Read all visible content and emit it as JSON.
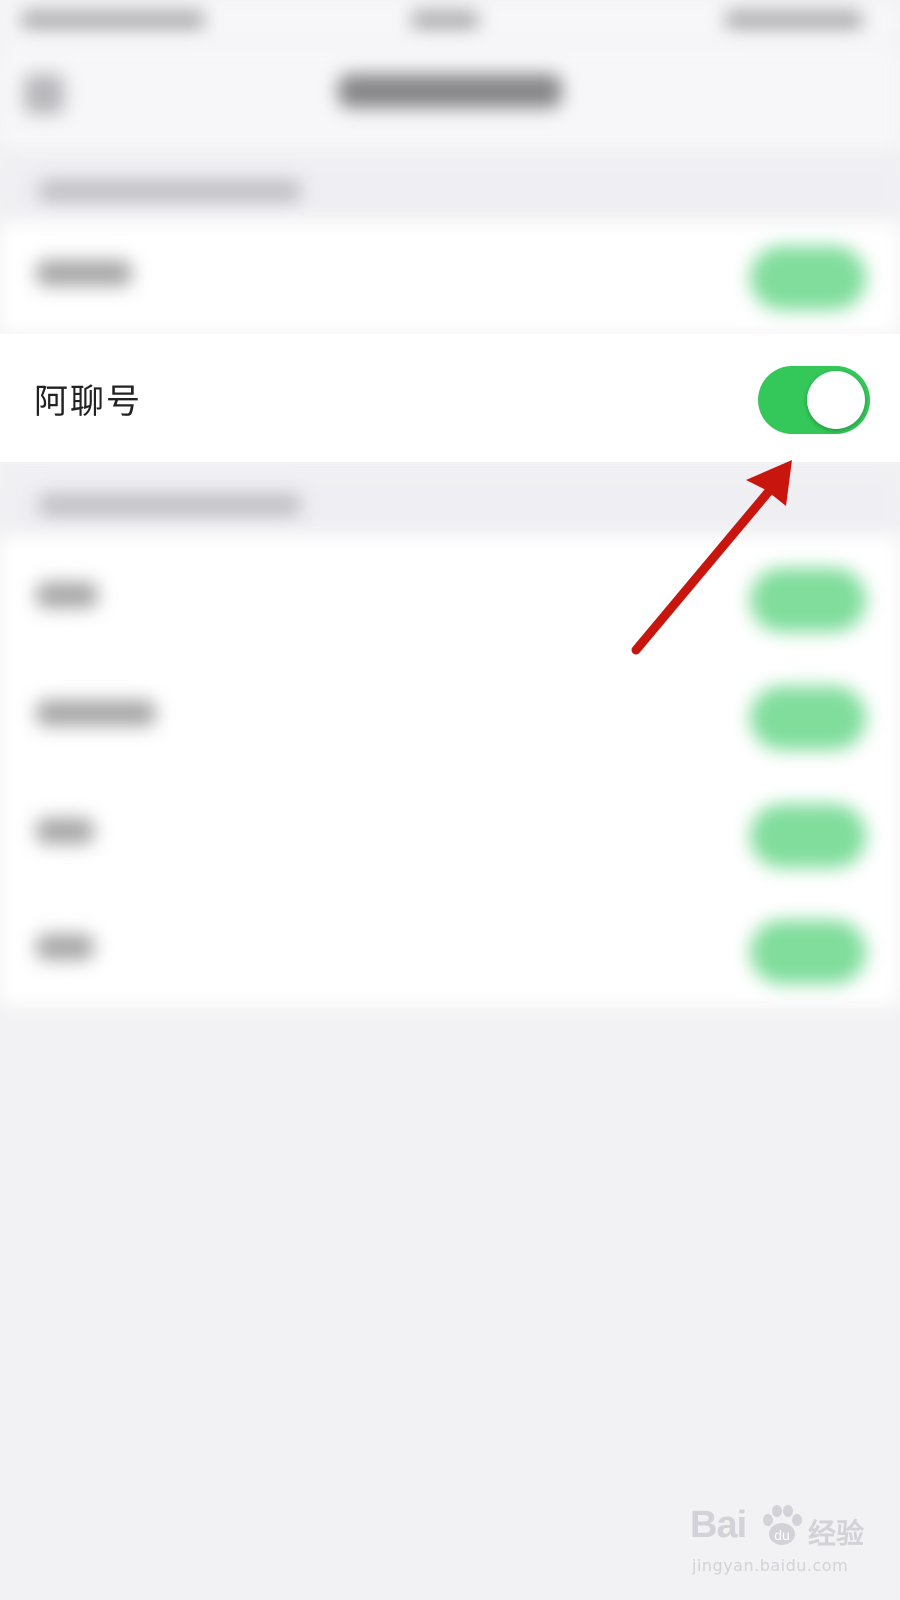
{
  "settings": {
    "highlighted_item": {
      "label": "阿聊号",
      "toggle_on": true
    }
  },
  "colors": {
    "toggle_on": "#34c759",
    "arrow": "#c8160f",
    "background": "#f2f2f4"
  },
  "watermark": {
    "brand": "Bai",
    "brand_suffix": "经验",
    "url": "jingyan.baidu.com"
  }
}
